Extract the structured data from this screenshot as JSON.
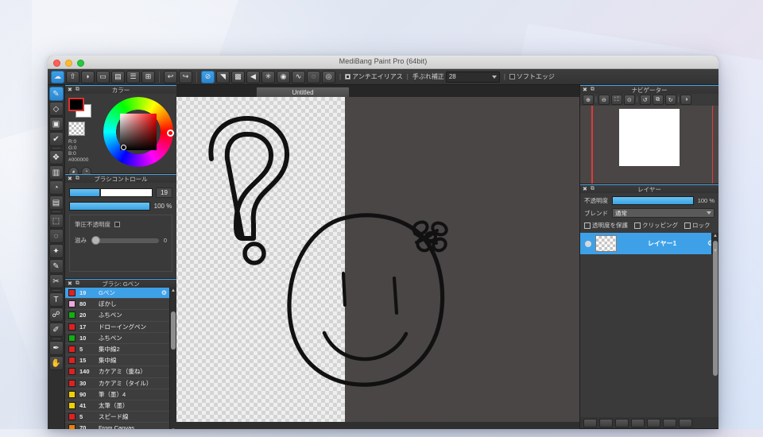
{
  "window": {
    "title": "MediBang Paint Pro (64bit)",
    "traffic_lights": [
      "close",
      "minimize",
      "maximize"
    ]
  },
  "toolbar": {
    "file_buttons": [
      {
        "name": "cloud-save-icon",
        "glyph": "☁",
        "active": true
      },
      {
        "name": "cloud-upload-icon",
        "glyph": "⇧"
      },
      {
        "name": "comment-icon",
        "glyph": "●"
      },
      {
        "name": "panel-icon",
        "glyph": "▭"
      },
      {
        "name": "page-icon",
        "glyph": "▤"
      },
      {
        "name": "list-icon",
        "glyph": "☰"
      },
      {
        "name": "grid-icon",
        "glyph": "⊞"
      }
    ],
    "undo_label": "↶",
    "redo_label": "↷",
    "brush_mode_buttons": [
      {
        "name": "no-texture-icon",
        "glyph": "⊘",
        "active": true
      },
      {
        "name": "gradient-texture-icon",
        "glyph": "◥"
      },
      {
        "name": "square-texture-icon",
        "glyph": "■"
      },
      {
        "name": "triangle-texture-icon",
        "glyph": "◀"
      },
      {
        "name": "sparkle-texture-icon",
        "glyph": "✳"
      },
      {
        "name": "halftone-texture-icon",
        "glyph": "◉"
      },
      {
        "name": "curve-texture-icon",
        "glyph": "∿"
      },
      {
        "name": "ring-texture-icon",
        "glyph": "◌"
      },
      {
        "name": "target-texture-icon",
        "glyph": "◎"
      }
    ],
    "antialias_label": "アンチエイリアス",
    "antialias_checked": true,
    "stabilizer_label": "手ぶれ補正",
    "stabilizer_value": "28",
    "soft_edge_label": "ソフトエッジ",
    "soft_edge_checked": false,
    "separator": "|"
  },
  "tools": [
    {
      "name": "brush-tool",
      "glyph": "╱",
      "active": true
    },
    {
      "name": "eraser-tool",
      "glyph": "◇"
    },
    {
      "name": "rectangle-tool",
      "glyph": "□"
    },
    {
      "name": "checkmark-tool",
      "glyph": "✔"
    },
    {
      "name": "move-tool",
      "glyph": "✥"
    },
    {
      "name": "fill-rect-tool",
      "glyph": "■"
    },
    {
      "name": "bucket-tool",
      "glyph": "◔"
    },
    {
      "name": "gradient-tool",
      "glyph": "▤"
    },
    {
      "name": "marquee-select-tool",
      "glyph": "⬚"
    },
    {
      "name": "lasso-select-tool",
      "glyph": "○"
    },
    {
      "name": "magic-wand-tool",
      "glyph": "✨"
    },
    {
      "name": "select-pen-tool",
      "glyph": "✎"
    },
    {
      "name": "select-eraser-tool",
      "glyph": "✄"
    },
    {
      "name": "text-tool",
      "glyph": "T"
    },
    {
      "name": "operation-tool",
      "glyph": "☍"
    },
    {
      "name": "eyedropper-tool",
      "glyph": "✐"
    },
    {
      "name": "pen-tool",
      "glyph": "✒"
    },
    {
      "name": "hand-tool",
      "glyph": "✋"
    }
  ],
  "color_panel": {
    "title": "カラー",
    "close_glyph": "✖",
    "dock_glyph": "⧉",
    "r_label": "R:0",
    "g_label": "G:0",
    "b_label": "B:0",
    "hex_label": "#000000",
    "foreground": "#000000",
    "background": "#ffffff",
    "buttons": [
      {
        "name": "color-palette-button",
        "glyph": "◕"
      },
      {
        "name": "color-mix-button",
        "glyph": "◔"
      }
    ]
  },
  "brush_control": {
    "title": "ブラシコントロール",
    "close_glyph": "✖",
    "dock_glyph": "⧉",
    "size_value": "19",
    "size_fill_pct": 36,
    "opacity_value": "100 %",
    "opacity_fill_pct": 100,
    "pressure_opacity_label": "筆圧不透明度",
    "pressure_opacity_checked": false,
    "blur_label": "滋み",
    "blur_value": "0"
  },
  "brush_panel": {
    "title": "ブラシ: Gペン",
    "close_glyph": "✖",
    "dock_glyph": "⧉",
    "gear_glyph": "⚙",
    "brushes": [
      {
        "color": "#e02020",
        "size": "19",
        "name": "Gペン",
        "selected": true
      },
      {
        "color": "#f0a8e0",
        "size": "80",
        "name": "ぼかし"
      },
      {
        "color": "#10b010",
        "size": "20",
        "name": "ふちペン"
      },
      {
        "color": "#e02020",
        "size": "17",
        "name": "ドローイングペン"
      },
      {
        "color": "#10b010",
        "size": "10",
        "name": "ふちペン"
      },
      {
        "color": "#e02020",
        "size": "5",
        "name": "集中線2"
      },
      {
        "color": "#e02020",
        "size": "15",
        "name": "集中線"
      },
      {
        "color": "#e02020",
        "size": "140",
        "name": "カケアミ（重ね）"
      },
      {
        "color": "#e02020",
        "size": "30",
        "name": "カケアミ（タイル）"
      },
      {
        "color": "#f0d000",
        "size": "90",
        "name": "筆（墨）4"
      },
      {
        "color": "#f0d000",
        "size": "41",
        "name": "太筆（墨）"
      },
      {
        "color": "#e02020",
        "size": "5",
        "name": "スピード線"
      },
      {
        "color": "#f08000",
        "size": "70",
        "name": "From Canvas"
      }
    ]
  },
  "canvas": {
    "tab_label": "Untitled",
    "artwork_description": "hand-drawn question mark and smiley face with flower"
  },
  "navigator": {
    "title": "ナビゲーター",
    "close_glyph": "✖",
    "dock_glyph": "⧉",
    "buttons": [
      {
        "name": "zoom-in-icon",
        "glyph": "⊕"
      },
      {
        "name": "zoom-fit-width-icon",
        "glyph": "⊖"
      },
      {
        "name": "fit-screen-icon",
        "glyph": "⛶"
      },
      {
        "name": "zoom-out-icon",
        "glyph": "⊙"
      },
      {
        "name": "rotate-left-icon",
        "glyph": "↺"
      },
      {
        "name": "flip-horizontal-icon",
        "glyph": "⧉"
      },
      {
        "name": "rotate-right-icon",
        "glyph": "↻"
      },
      {
        "name": "lock-rotation-icon",
        "glyph": "◑"
      }
    ]
  },
  "layers": {
    "title": "レイヤー",
    "close_glyph": "✖",
    "dock_glyph": "⧉",
    "opacity_label": "不透明度",
    "opacity_value": "100 %",
    "blend_label": "ブレンド",
    "blend_value": "通常",
    "protect_alpha_label": "透明度を保護",
    "clipping_label": "クリッピング",
    "lock_label": "ロック",
    "items": [
      {
        "name": "レイヤー1",
        "visible": true,
        "selected": true
      }
    ],
    "gear_glyph": "⚙"
  },
  "colors": {
    "accent": "#3ea1e8",
    "panel_bg": "#3a3a3a",
    "window_bg": "#2b2b2b",
    "canvas_bg": "#4b4646",
    "navigator_line": "#e03b3b"
  }
}
